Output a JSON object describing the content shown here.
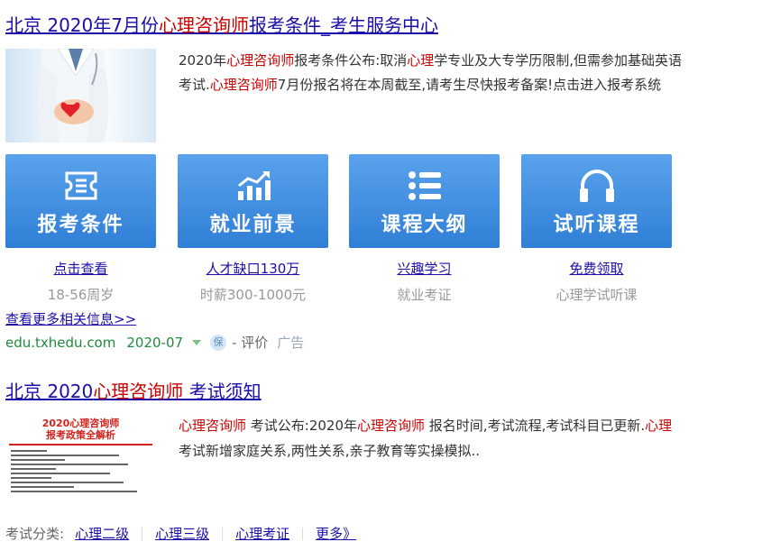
{
  "result1": {
    "title": [
      {
        "text": "北京 2020年7月份",
        "em": false
      },
      {
        "text": "心理咨询师",
        "em": true
      },
      {
        "text": "报考条件_考生服务中心",
        "em": false
      }
    ],
    "description": [
      {
        "text": "2020年",
        "em": false
      },
      {
        "text": "心理咨询师",
        "em": true
      },
      {
        "text": "报考条件公布:取消",
        "em": false
      },
      {
        "text": "心理",
        "em": true
      },
      {
        "text": "学专业及大专学历限制,但需参加基础英语考试.",
        "em": false
      },
      {
        "text": "心理咨询师",
        "em": true
      },
      {
        "text": "7月份报名将在本周截至,请考生尽快报考备案!点击进入报考系统",
        "em": false
      }
    ],
    "cards": [
      {
        "icon": "ticket-icon",
        "label": "报考条件",
        "link": "点击查看",
        "note": "18-56周岁"
      },
      {
        "icon": "bar-chart-icon",
        "label": "就业前景",
        "link": "人才缺口130万",
        "note": "时薪300-1000元"
      },
      {
        "icon": "list-icon",
        "label": "课程大纲",
        "link": "兴趣学习",
        "note": "就业考证"
      },
      {
        "icon": "headphones-icon",
        "label": "试听课程",
        "link": "免费领取",
        "note": "心理学试听课"
      }
    ],
    "more_link": "查看更多相关信息>>",
    "source": {
      "url": "edu.txhedu.com",
      "date": "2020-07",
      "badge": "保",
      "evaluate": "- 评价",
      "ad": "广告"
    }
  },
  "result2": {
    "title": [
      {
        "text": "北京 2020",
        "em": false
      },
      {
        "text": "心理咨询师",
        "em": true
      },
      {
        "text": " 考试须知",
        "em": false
      }
    ],
    "thumb": {
      "line1": "2020心理咨询师",
      "line2": "报考政策全解析"
    },
    "description": [
      {
        "text": "心理咨询师",
        "em": true
      },
      {
        "text": " 考试公布:2020年",
        "em": false
      },
      {
        "text": "心理咨询师",
        "em": true
      },
      {
        "text": " 报名时间,考试流程,考试科目已更新.",
        "em": false
      },
      {
        "text": "心理",
        "em": true
      },
      {
        "text": "考试新增家庭关系,两性关系,亲子教育等实操模拟..",
        "em": false
      }
    ]
  },
  "categories": {
    "label": "考试分类:",
    "items": [
      "心理二级",
      "心理三级",
      "心理考证",
      "更多》"
    ]
  },
  "colors": {
    "card_bg": "#3a8ae0",
    "highlight": "#cc0000",
    "link": "#1a0dab",
    "source": "#1f8a3b"
  }
}
